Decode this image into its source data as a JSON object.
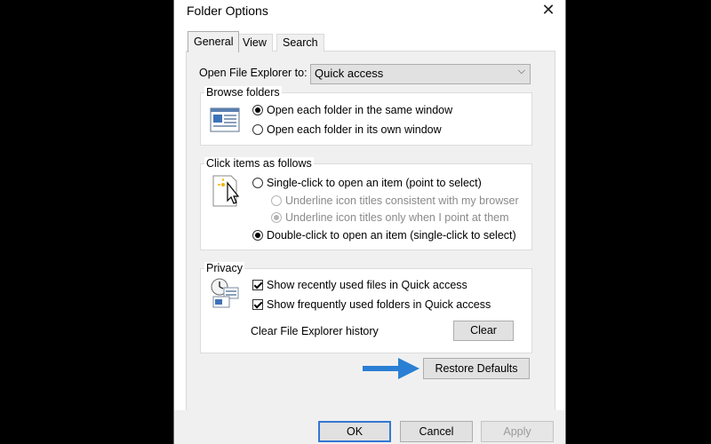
{
  "window": {
    "title": "Folder Options"
  },
  "tabs": [
    {
      "label": "General",
      "active": true
    },
    {
      "label": "View",
      "active": false
    },
    {
      "label": "Search",
      "active": false
    }
  ],
  "open_to": {
    "label": "Open File Explorer to:",
    "value": "Quick access"
  },
  "browse": {
    "legend": "Browse folders",
    "same_window": "Open each folder in the same window",
    "own_window": "Open each folder in its own window",
    "selected": "same_window"
  },
  "click": {
    "legend": "Click items as follows",
    "single": "Single-click to open an item (point to select)",
    "underline_browser": "Underline icon titles consistent with my browser",
    "underline_point": "Underline icon titles only when I point at them",
    "double": "Double-click to open an item (single-click to select)",
    "selected": "double"
  },
  "privacy": {
    "legend": "Privacy",
    "recent_files": "Show recently used files in Quick access",
    "frequent_folders": "Show frequently used folders in Quick access",
    "recent_checked": true,
    "frequent_checked": true,
    "clear_label": "Clear File Explorer history",
    "clear_button": "Clear"
  },
  "restore_button": "Restore Defaults",
  "footer": {
    "ok": "OK",
    "cancel": "Cancel",
    "apply": "Apply"
  },
  "colors": {
    "accent": "#3478d4",
    "arrow": "#2a7fd4"
  },
  "icons": [
    "close-icon",
    "dropdown-arrow-icon",
    "folder-window-icon",
    "pointer-click-icon",
    "privacy-icon",
    "blue-arrow-icon"
  ]
}
